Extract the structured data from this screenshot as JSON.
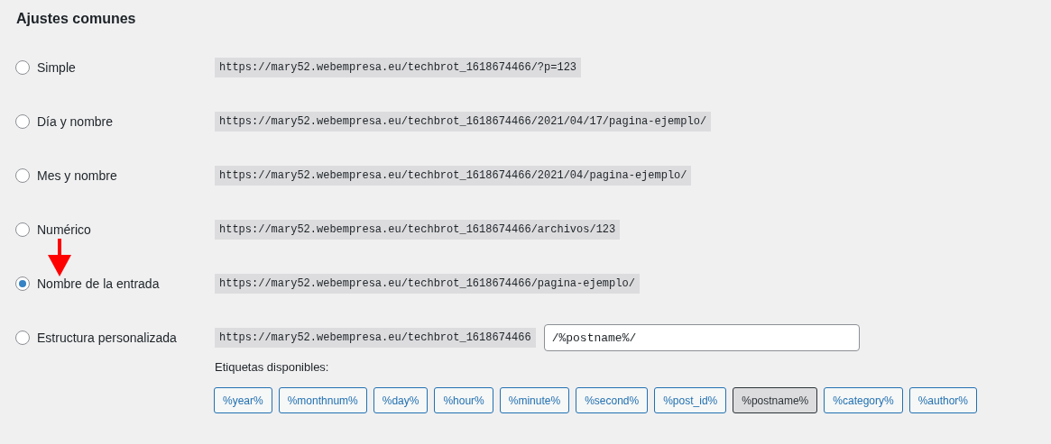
{
  "heading": "Ajustes comunes",
  "options": [
    {
      "label": "Simple",
      "example": "https://mary52.webempresa.eu/techbrot_1618674466/?p=123",
      "selected": false
    },
    {
      "label": "Día y nombre",
      "example": "https://mary52.webempresa.eu/techbrot_1618674466/2021/04/17/pagina-ejemplo/",
      "selected": false
    },
    {
      "label": "Mes y nombre",
      "example": "https://mary52.webempresa.eu/techbrot_1618674466/2021/04/pagina-ejemplo/",
      "selected": false
    },
    {
      "label": "Numérico",
      "example": "https://mary52.webempresa.eu/techbrot_1618674466/archivos/123",
      "selected": false
    },
    {
      "label": "Nombre de la entrada",
      "example": "https://mary52.webempresa.eu/techbrot_1618674466/pagina-ejemplo/",
      "selected": true
    },
    {
      "label": "Estructura personalizada",
      "example": "https://mary52.webempresa.eu/techbrot_1618674466",
      "selected": false,
      "value": "/%postname%/"
    }
  ],
  "tags_label": "Etiquetas disponibles:",
  "tags": [
    {
      "label": "%year%",
      "selected": false
    },
    {
      "label": "%monthnum%",
      "selected": false
    },
    {
      "label": "%day%",
      "selected": false
    },
    {
      "label": "%hour%",
      "selected": false
    },
    {
      "label": "%minute%",
      "selected": false
    },
    {
      "label": "%second%",
      "selected": false
    },
    {
      "label": "%post_id%",
      "selected": false
    },
    {
      "label": "%postname%",
      "selected": true
    },
    {
      "label": "%category%",
      "selected": false
    },
    {
      "label": "%author%",
      "selected": false
    }
  ]
}
